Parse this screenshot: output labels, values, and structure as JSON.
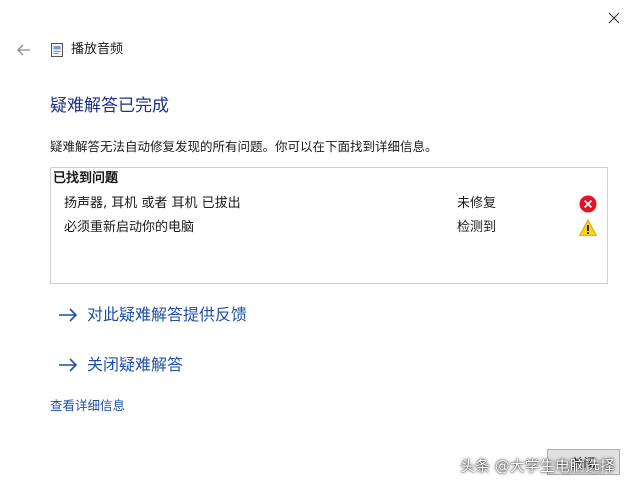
{
  "window": {
    "title": "播放音频",
    "back_icon": "back-arrow-icon",
    "close_icon": "close-icon"
  },
  "main": {
    "heading": "疑难解答已完成",
    "description": "疑难解答无法自动修复发现的所有问题。你可以在下面找到详细信息。"
  },
  "problems": {
    "header": "已找到问题",
    "items": [
      {
        "name": "扬声器, 耳机 或者 耳机 已拔出",
        "status": "未修复",
        "icon": "error-icon",
        "icon_color": "#e81123"
      },
      {
        "name": "必须重新启动你的电脑",
        "status": "检测到",
        "icon": "warning-icon",
        "icon_color": "#fcd116"
      }
    ]
  },
  "links": {
    "feedback": "对此疑难解答提供反馈",
    "close_troubleshooter": "关闭疑难解答",
    "view_details": "查看详细信息"
  },
  "footer": {
    "close_button": "关闭"
  },
  "watermark": "头条 @大学生电脑选择",
  "colors": {
    "heading": "#1e3287",
    "link": "#1e4fa8",
    "error": "#e81123",
    "warning": "#fcd116"
  }
}
